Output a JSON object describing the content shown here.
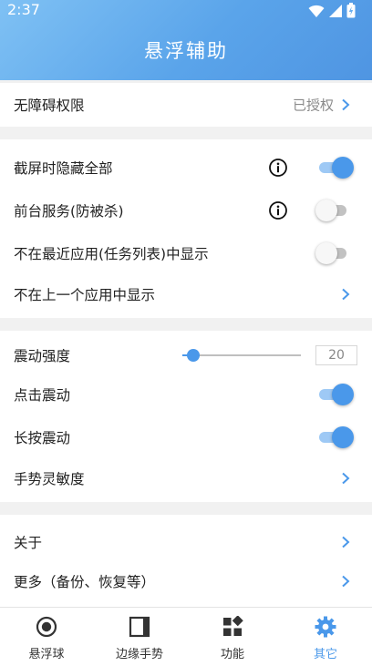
{
  "status": {
    "time": "2:37"
  },
  "header": {
    "title": "悬浮辅助"
  },
  "sections": {
    "permission": {
      "label": "无障碍权限",
      "value": "已授权"
    },
    "display": {
      "screenshot_hide": {
        "label": "截屏时隐藏全部",
        "on": true
      },
      "foreground_service": {
        "label": "前台服务(防被杀)",
        "on": false
      },
      "hide_recents": {
        "label": "不在最近应用(任务列表)中显示",
        "on": false
      },
      "hide_last_app": {
        "label": "不在上一个应用中显示"
      }
    },
    "vibration": {
      "strength": {
        "label": "震动强度",
        "value": "20",
        "fraction": 0.09
      },
      "tap": {
        "label": "点击震动",
        "on": true
      },
      "long_press": {
        "label": "长按震动",
        "on": true
      },
      "gesture_sensitivity": {
        "label": "手势灵敏度"
      }
    },
    "about": {
      "about": {
        "label": "关于"
      },
      "more": {
        "label": "更多（备份、恢复等）"
      }
    }
  },
  "nav": [
    {
      "label": "悬浮球",
      "icon": "floating-ball-icon",
      "active": false
    },
    {
      "label": "边缘手势",
      "icon": "edge-gesture-icon",
      "active": false
    },
    {
      "label": "功能",
      "icon": "functions-grid-icon",
      "active": false
    },
    {
      "label": "其它",
      "icon": "gear-icon",
      "active": true
    }
  ],
  "colors": {
    "accent": "#4a98ea",
    "header_start": "#7fc1f4",
    "header_end": "#4f95e2"
  }
}
